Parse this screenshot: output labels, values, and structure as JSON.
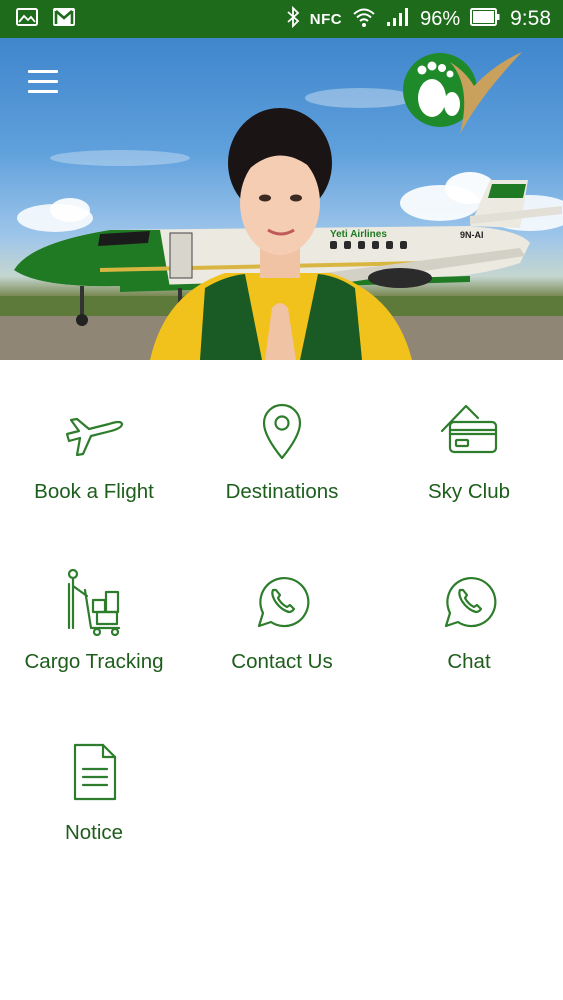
{
  "status_bar": {
    "nfc": "NFC",
    "battery": "96%",
    "time": "9:58",
    "icons": [
      "image-icon",
      "gmail-icon",
      "bluetooth-icon",
      "nfc-icon",
      "wifi-icon",
      "signal-icon",
      "battery-icon"
    ]
  },
  "colors": {
    "status_bar": "#1d6b1b",
    "accent": "#2e7d2c",
    "label": "#1e5e1c"
  },
  "hero": {
    "airline_name": "Yeti Airlines",
    "registration": "9N-AI"
  },
  "menu": [
    {
      "label": "Book a Flight",
      "icon": "airplane-icon"
    },
    {
      "label": "Destinations",
      "icon": "location-pin-icon"
    },
    {
      "label": "Sky Club",
      "icon": "card-icon"
    },
    {
      "label": "Cargo Tracking",
      "icon": "cargo-cart-icon"
    },
    {
      "label": "Contact Us",
      "icon": "phone-chat-icon"
    },
    {
      "label": "Chat",
      "icon": "phone-chat-icon"
    },
    {
      "label": "Notice",
      "icon": "document-icon"
    }
  ]
}
